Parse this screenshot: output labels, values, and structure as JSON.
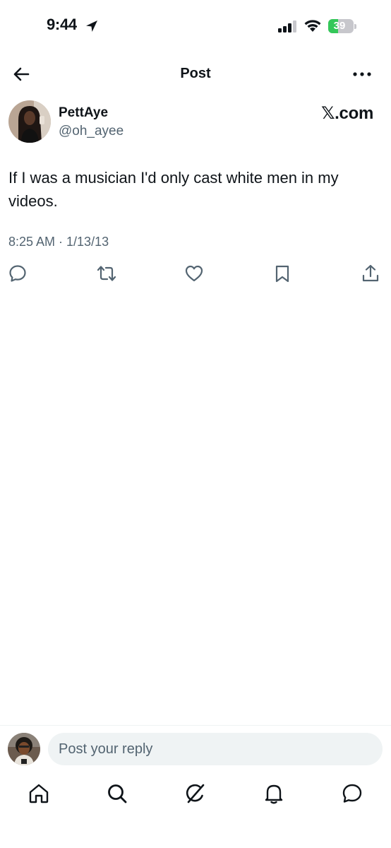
{
  "status_bar": {
    "time": "9:44",
    "battery_percent": 39,
    "battery_label": "39",
    "icons": [
      "location-arrow-icon",
      "cellular-signal-icon",
      "wifi-icon",
      "battery-charging-icon"
    ]
  },
  "header": {
    "title": "Post",
    "back_icon": "arrow-left-icon",
    "more_icon": "more-dots-icon"
  },
  "tweet": {
    "display_name": "PettAye",
    "handle": "@oh_ayee",
    "source": "𝕏.com",
    "text": "If I was a musician I'd only cast white men in my videos.",
    "timestamp": "8:25 AM · 1/13/13",
    "actions": [
      "reply-icon",
      "retweet-icon",
      "like-icon",
      "bookmark-icon",
      "share-icon"
    ]
  },
  "reply": {
    "placeholder": "Post your reply"
  },
  "tab_bar": {
    "items": [
      "home-icon",
      "search-icon",
      "grok-icon",
      "notifications-icon",
      "messages-icon"
    ]
  },
  "colors": {
    "text": "#0f1419",
    "secondary": "#536471",
    "battery_green": "#34c759",
    "input_bg": "#eff3f4"
  }
}
